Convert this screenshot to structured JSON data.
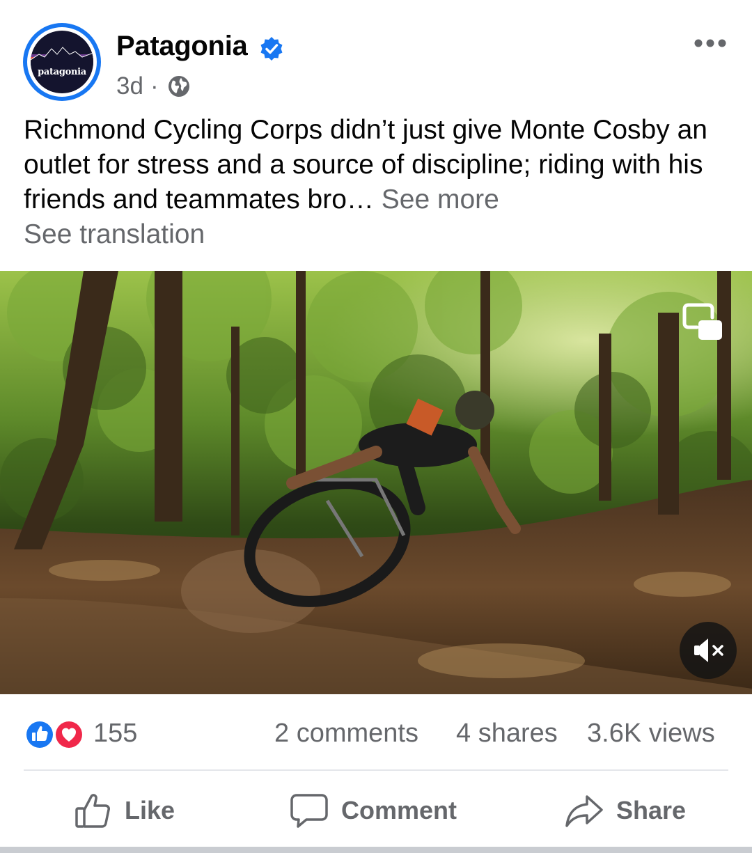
{
  "post": {
    "page_name": "Patagonia",
    "timestamp": "3d",
    "separator": "·",
    "visibility_icon": "globe-icon",
    "verified_icon": "verified-badge-icon",
    "avatar_text": "patagonia",
    "text": "Richmond Cycling Corps didn’t just give Monte Cosby an outlet for stress and a source of discipline; riding with his friends and teammates bro…",
    "see_more": "See more",
    "see_translation": "See translation"
  },
  "video": {
    "pip_icon": "picture-in-picture-icon",
    "mute_icon": "muted-speaker-icon"
  },
  "stats": {
    "reaction_icons": [
      "like-icon",
      "love-icon"
    ],
    "reaction_count": "155",
    "comments": "2 comments",
    "shares": "4 shares",
    "views": "3.6K views"
  },
  "actions": {
    "like": "Like",
    "comment": "Comment",
    "share": "Share"
  },
  "colors": {
    "accent_blue": "#1877f2",
    "secondary_text": "#65676b",
    "love_red": "#f0284a"
  }
}
